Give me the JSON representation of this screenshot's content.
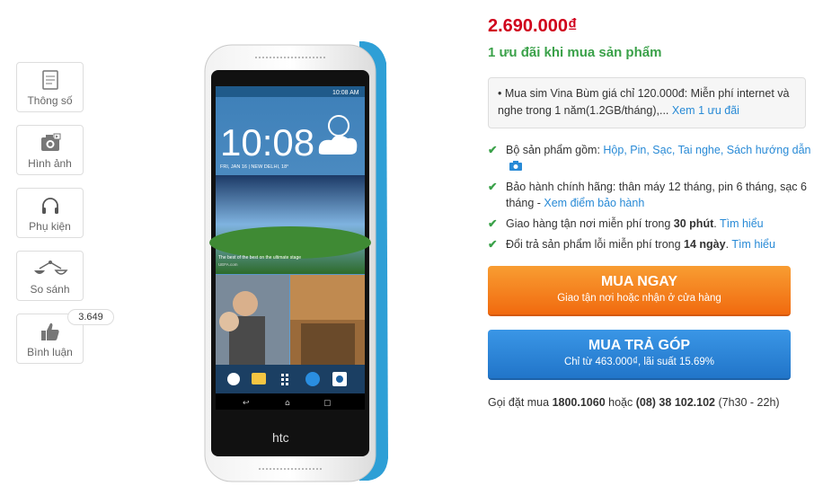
{
  "sidebar": {
    "items": [
      {
        "label": "Thông số",
        "icon": "document-icon"
      },
      {
        "label": "Hình ảnh",
        "icon": "camera-icon"
      },
      {
        "label": "Phụ kiện",
        "icon": "headphones-icon"
      },
      {
        "label": "So sánh",
        "icon": "scale-icon"
      },
      {
        "label": "Bình luận",
        "icon": "thumbs-up-icon",
        "badge": "3.649"
      }
    ]
  },
  "product": {
    "price": "2.690.000₫",
    "promo_title": "1 ưu đãi khi mua sản phẩm",
    "promo_text": "• Mua sim Vina Bùm giá chỉ 120.000đ: Miễn phí internet và nghe trong 1 năm(1.2GB/tháng),...",
    "promo_link": "Xem 1 ưu đãi",
    "features": [
      {
        "text": "Bộ sản phẩm gồm: ",
        "link": "Hộp, Pin, Sạc, Tai nghe, Sách hướng dẫn"
      },
      {
        "text": "Bảo hành chính hãng: thân máy 12 tháng, pin 6 tháng, sạc 6 tháng - ",
        "link": "Xem điểm bảo hành"
      },
      {
        "text_pre": "Giao hàng tận nơi miễn phí trong ",
        "bold": "30 phút",
        "text_post": ". ",
        "link": "Tìm hiểu"
      },
      {
        "text_pre": "Đổi trả sản phẩm lỗi miễn phí trong ",
        "bold": "14 ngày",
        "text_post": ". ",
        "link": "Tìm hiểu"
      }
    ],
    "buy_button": {
      "title": "MUA NGAY",
      "subtitle": "Giao tận nơi hoặc nhận ở cửa hàng"
    },
    "installment_button": {
      "title": "MUA TRẢ GÓP",
      "subtitle": "Chỉ từ 463.000₫, lãi suất 15.69%"
    },
    "hotline": {
      "prefix": "Gọi đặt mua ",
      "phone1": "1800.1060",
      "middle": " hoặc ",
      "phone2": "(08) 38 102.102",
      "suffix": " (7h30 - 22h)"
    }
  },
  "phone_screen": {
    "status_time": "10:08 AM",
    "clock": "10:08",
    "date_line": "FRI, JAN 16 | NEW DELHI, 18°",
    "news_text": "The best of the best on the ultimate stage",
    "news_source": "UEFA.com",
    "brand": "htc"
  },
  "colors": {
    "price": "#d0021b",
    "promo": "#3aa149",
    "link": "#288ad6",
    "buy": "#f16a0f",
    "installment": "#2175c9"
  }
}
